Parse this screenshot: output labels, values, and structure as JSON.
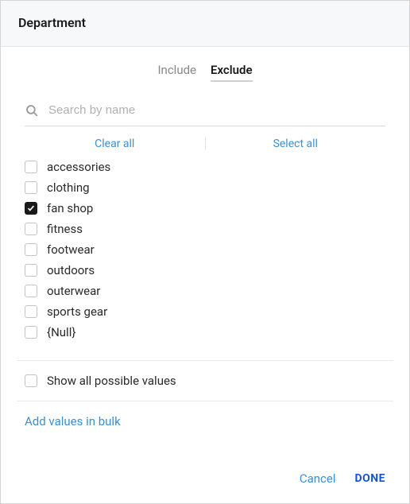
{
  "header": {
    "title": "Department"
  },
  "tabs": {
    "include": {
      "label": "Include",
      "active": false
    },
    "exclude": {
      "label": "Exclude",
      "active": true
    }
  },
  "search": {
    "placeholder": "Search by name",
    "value": ""
  },
  "actions": {
    "clear_all": "Clear all",
    "select_all": "Select all"
  },
  "items": [
    {
      "label": "accessories",
      "checked": false
    },
    {
      "label": "clothing",
      "checked": false
    },
    {
      "label": "fan shop",
      "checked": true
    },
    {
      "label": "fitness",
      "checked": false
    },
    {
      "label": "footwear",
      "checked": false
    },
    {
      "label": "outdoors",
      "checked": false
    },
    {
      "label": "outerwear",
      "checked": false
    },
    {
      "label": "sports gear",
      "checked": false
    },
    {
      "label": "{Null}",
      "checked": false
    }
  ],
  "show_all": {
    "label": "Show all possible values",
    "checked": false
  },
  "bulk_link": "Add values in bulk",
  "footer": {
    "cancel": "Cancel",
    "done": "DONE"
  }
}
